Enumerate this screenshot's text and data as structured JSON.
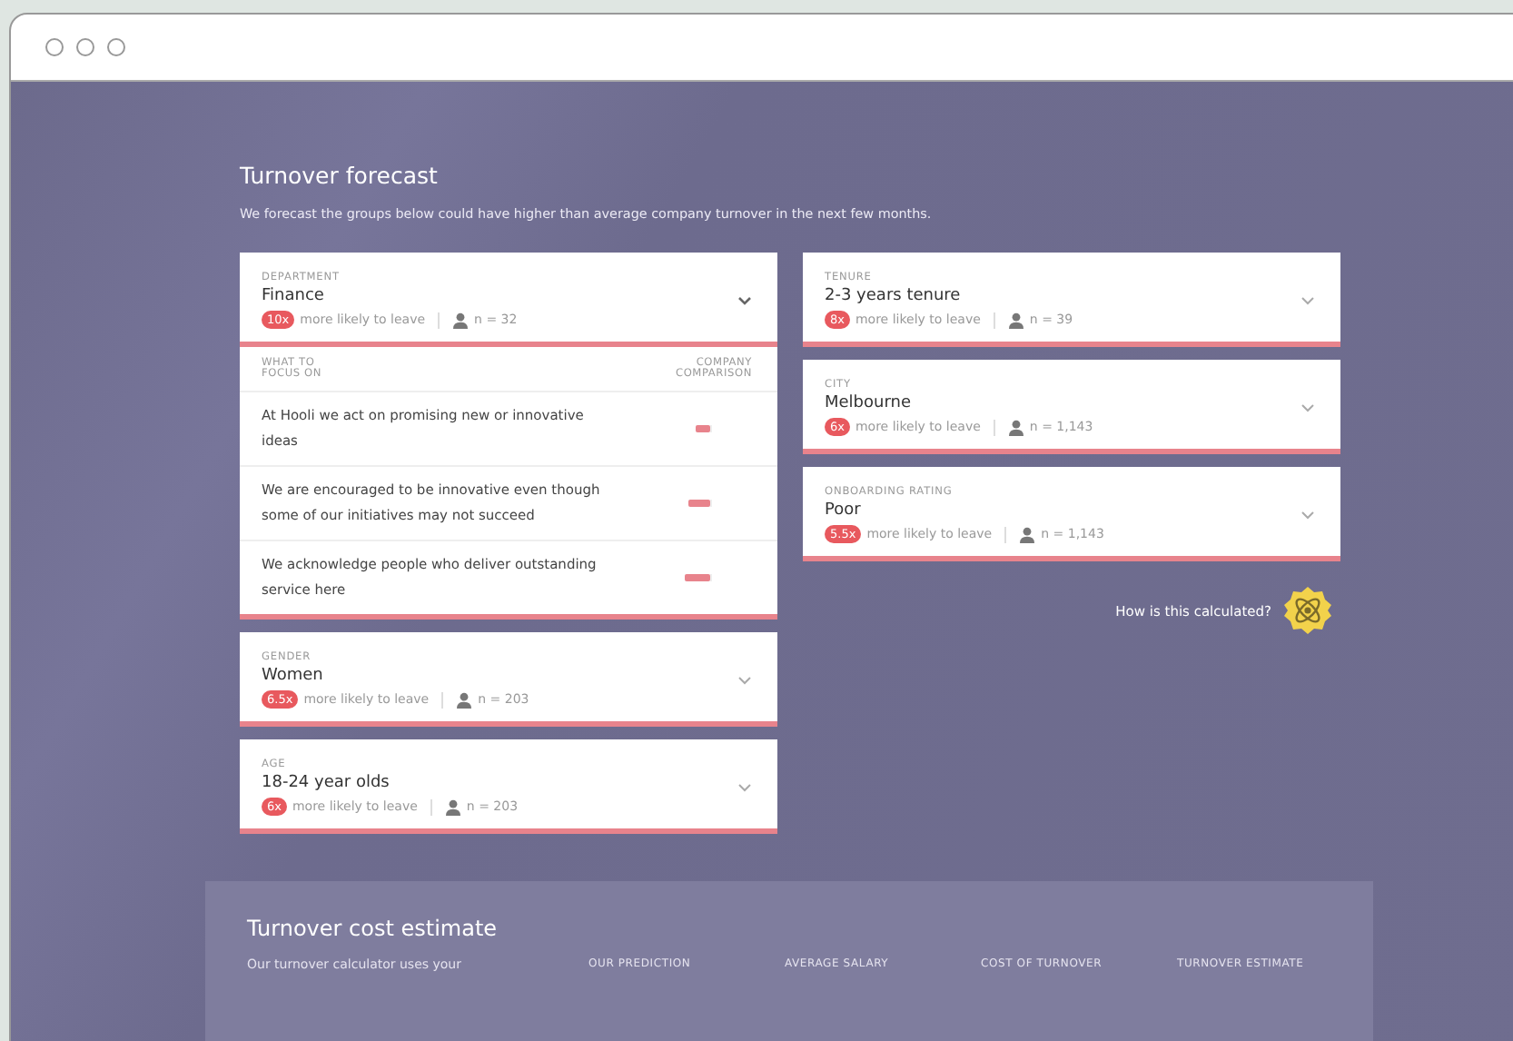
{
  "title": "Turnover forecast",
  "subtitle": "We forecast the groups below could have higher than average company turnover in the next few months.",
  "columns": [
    [
      {
        "category": "DEPARTMENT",
        "name": "Finance",
        "multiplier": "10x",
        "likelihood": "more likely to leave",
        "count": "n = 32",
        "expanded": true,
        "focus": {
          "header": "WHAT TO FOCUS ON",
          "comparison_header": "COMPANY COMPARISON",
          "items": [
            {
              "text": "At Hooli we act on promising new or innovative ideas",
              "level": 0.3
            },
            {
              "text": "We are encouraged to be innovative even though some of our initiatives may not succeed",
              "level": 0.45
            },
            {
              "text": "We acknowledge people who deliver outstanding service here",
              "level": 0.55
            }
          ]
        }
      },
      {
        "category": "GENDER",
        "name": "Women",
        "multiplier": "6.5x",
        "likelihood": "more likely to leave",
        "count": "n = 203",
        "expanded": false
      },
      {
        "category": "AGE",
        "name": "18-24 year olds",
        "multiplier": "6x",
        "likelihood": "more likely to leave",
        "count": "n = 203",
        "expanded": false
      }
    ],
    [
      {
        "category": "TENURE",
        "name": "2-3 years tenure",
        "multiplier": "8x",
        "likelihood": "more likely to leave",
        "count": "n = 39",
        "expanded": false
      },
      {
        "category": "CITY",
        "name": "Melbourne",
        "multiplier": "6x",
        "likelihood": "more likely to leave",
        "count": "n = 1,143",
        "expanded": false
      },
      {
        "category": "ONBOARDING RATING",
        "name": "Poor",
        "multiplier": "5.5x",
        "likelihood": "more likely to leave",
        "count": "n = 1,143",
        "expanded": false
      }
    ]
  ],
  "help_link": "How is this calculated?",
  "cost_estimate": {
    "title": "Turnover cost estimate",
    "text": "Our turnover calculator uses your",
    "columns": [
      "OUR PREDICTION",
      "AVERAGE SALARY",
      "COST OF TURNOVER",
      "TURNOVER ESTIMATE"
    ]
  }
}
